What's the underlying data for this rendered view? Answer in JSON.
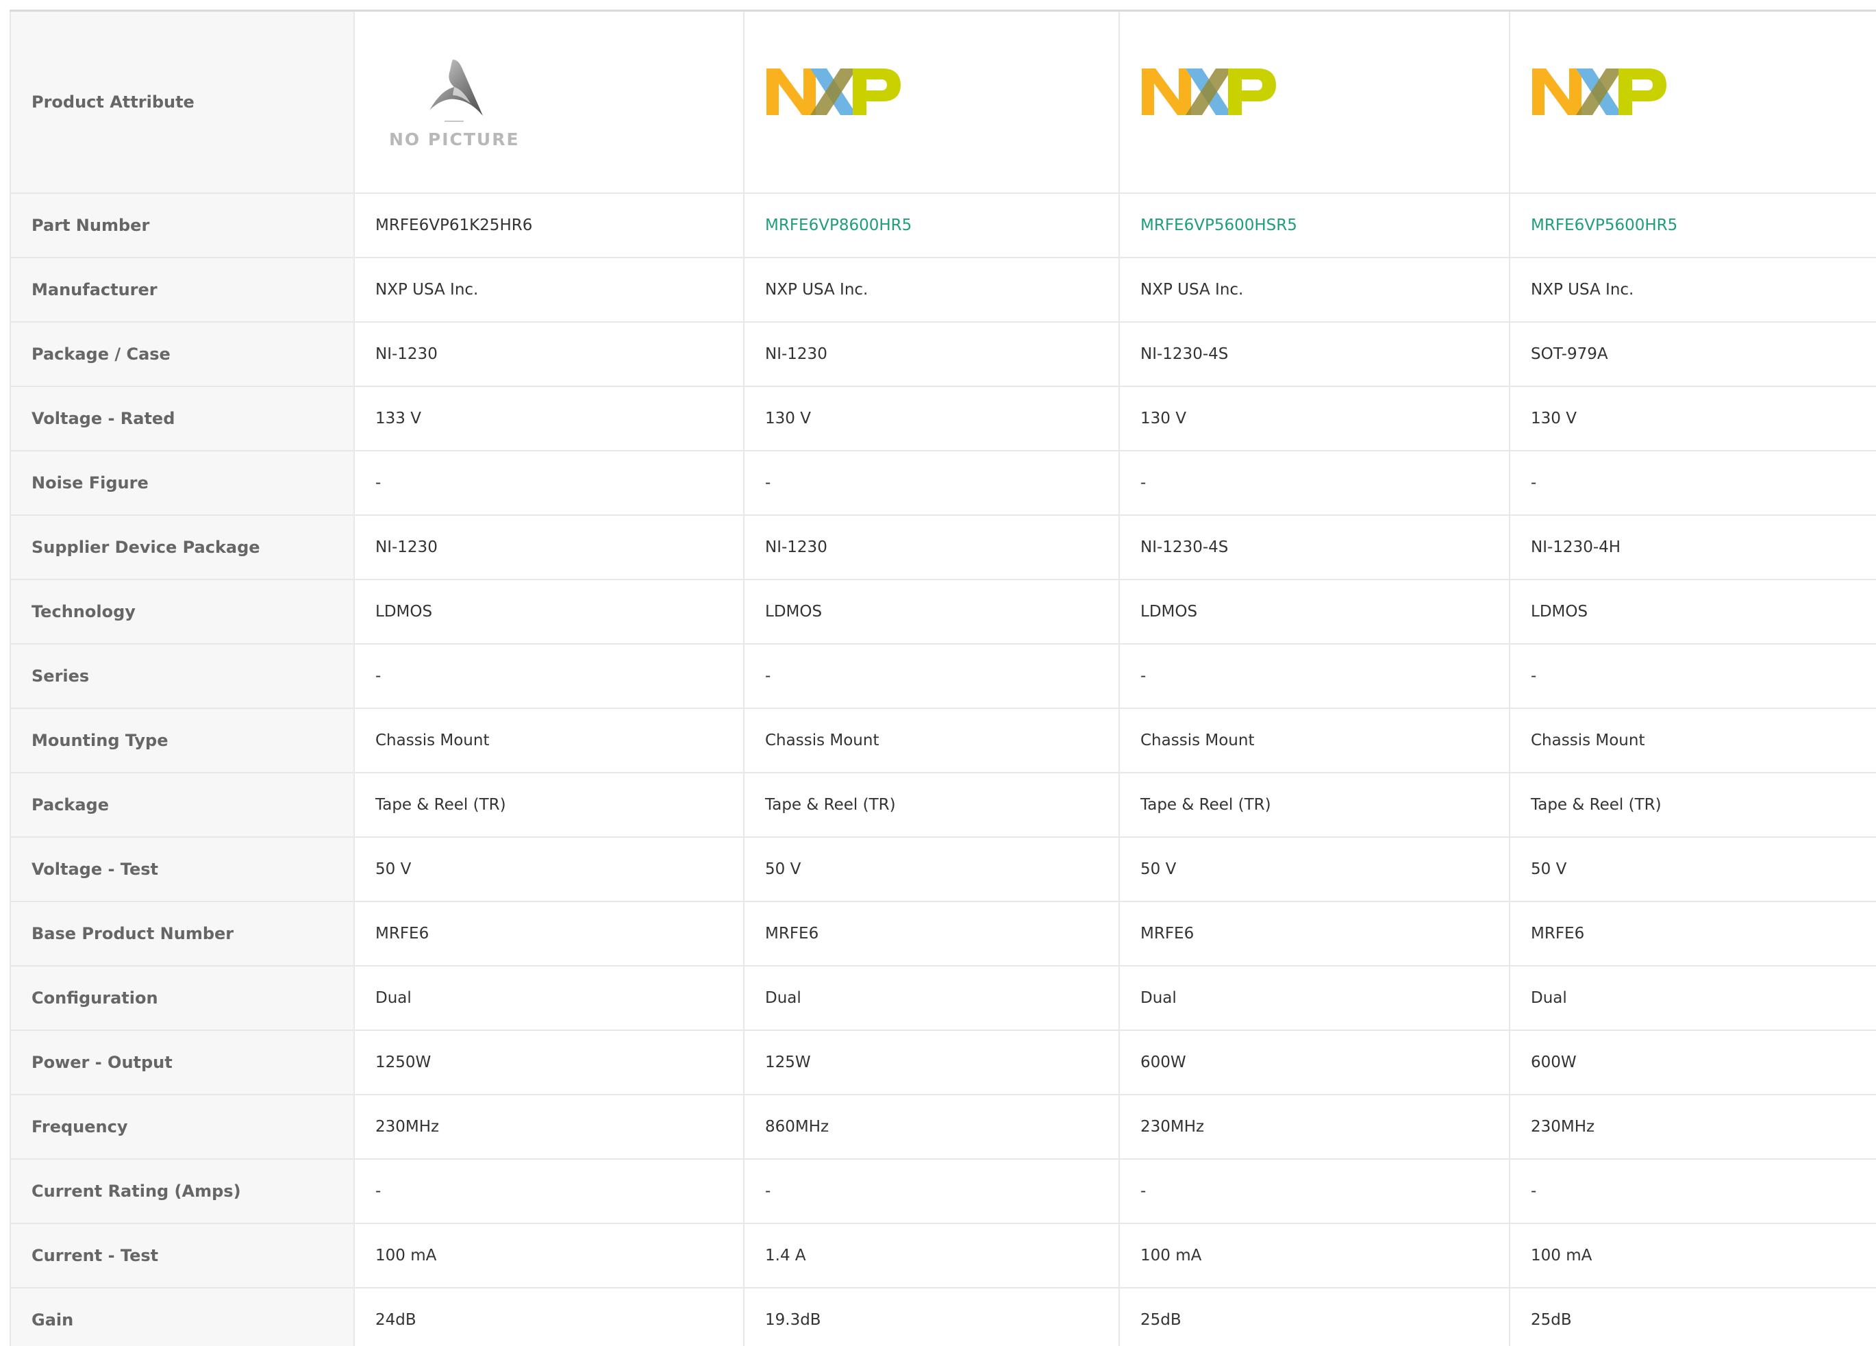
{
  "header_label": "Product Attribute",
  "no_picture_label": "NO PICTURE",
  "products": [
    {
      "image": "no-picture-placeholder",
      "part_number": "MRFE6VP61K25HR6",
      "linked": false
    },
    {
      "image": "nxp-logo",
      "part_number": "MRFE6VP8600HR5",
      "linked": true
    },
    {
      "image": "nxp-logo",
      "part_number": "MRFE6VP5600HSR5",
      "linked": true
    },
    {
      "image": "nxp-logo",
      "part_number": "MRFE6VP5600HR5",
      "linked": true
    }
  ],
  "rows": [
    {
      "label": "Part Number",
      "values": [
        "MRFE6VP61K25HR6",
        "MRFE6VP8600HR5",
        "MRFE6VP5600HSR5",
        "MRFE6VP5600HR5"
      ]
    },
    {
      "label": "Manufacturer",
      "values": [
        "NXP USA Inc.",
        "NXP USA Inc.",
        "NXP USA Inc.",
        "NXP USA Inc."
      ]
    },
    {
      "label": "Package / Case",
      "values": [
        "NI-1230",
        "NI-1230",
        "NI-1230-4S",
        "SOT-979A"
      ]
    },
    {
      "label": "Voltage - Rated",
      "values": [
        "133 V",
        "130 V",
        "130 V",
        "130 V"
      ]
    },
    {
      "label": "Noise Figure",
      "values": [
        "-",
        "-",
        "-",
        "-"
      ]
    },
    {
      "label": "Supplier Device Package",
      "values": [
        "NI-1230",
        "NI-1230",
        "NI-1230-4S",
        "NI-1230-4H"
      ]
    },
    {
      "label": "Technology",
      "values": [
        "LDMOS",
        "LDMOS",
        "LDMOS",
        "LDMOS"
      ]
    },
    {
      "label": "Series",
      "values": [
        "-",
        "-",
        "-",
        "-"
      ]
    },
    {
      "label": "Mounting Type",
      "values": [
        "Chassis Mount",
        "Chassis Mount",
        "Chassis Mount",
        "Chassis Mount"
      ]
    },
    {
      "label": "Package",
      "values": [
        "Tape & Reel (TR)",
        "Tape & Reel (TR)",
        "Tape & Reel (TR)",
        "Tape & Reel (TR)"
      ]
    },
    {
      "label": "Voltage - Test",
      "values": [
        "50 V",
        "50 V",
        "50 V",
        "50 V"
      ]
    },
    {
      "label": "Base Product Number",
      "values": [
        "MRFE6",
        "MRFE6",
        "MRFE6",
        "MRFE6"
      ]
    },
    {
      "label": "Configuration",
      "values": [
        "Dual",
        "Dual",
        "Dual",
        "Dual"
      ]
    },
    {
      "label": "Power - Output",
      "values": [
        "1250W",
        "125W",
        "600W",
        "600W"
      ]
    },
    {
      "label": "Frequency",
      "values": [
        "230MHz",
        "860MHz",
        "230MHz",
        "230MHz"
      ]
    },
    {
      "label": "Current Rating (Amps)",
      "values": [
        "-",
        "-",
        "-",
        "-"
      ]
    },
    {
      "label": "Current - Test",
      "values": [
        "100 mA",
        "1.4 A",
        "100 mA",
        "100 mA"
      ]
    },
    {
      "label": "Gain",
      "values": [
        "24dB",
        "19.3dB",
        "25dB",
        "25dB"
      ]
    }
  ],
  "colors": {
    "link": "#1f9e7a",
    "nxp_n": "#f9b21d",
    "nxp_x_blue": "#6fb5e3",
    "nxp_x_olive": "#958b3a",
    "nxp_p": "#c9d200"
  }
}
